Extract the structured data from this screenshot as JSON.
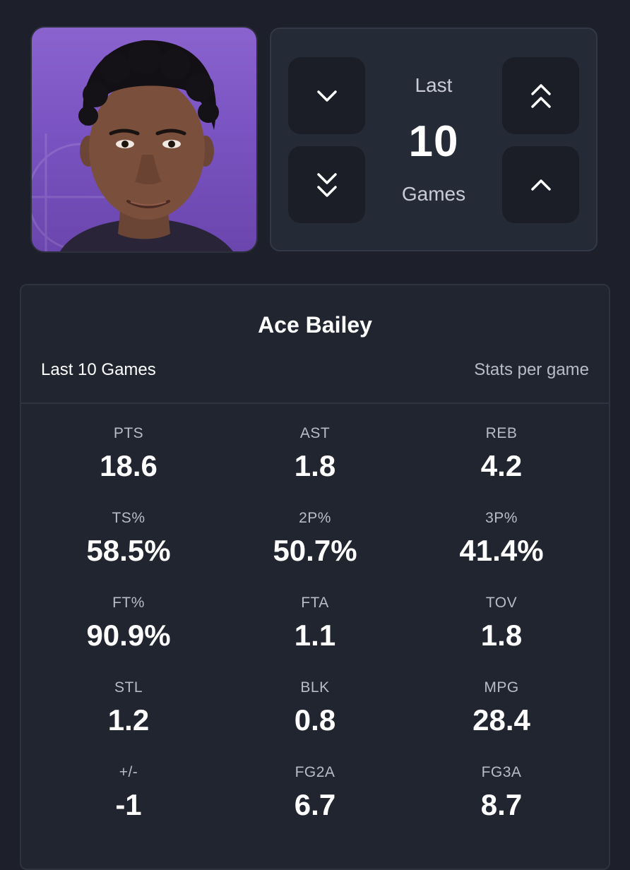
{
  "player": {
    "name": "Ace Bailey",
    "photo_alt": "Ace Bailey headshot"
  },
  "game_filter": {
    "prefix": "Last",
    "count": "10",
    "suffix": "Games",
    "buttons": {
      "decrease": "chevron-down-icon",
      "decrease_more": "double-chevron-down-icon",
      "increase_more": "double-chevron-up-icon",
      "increase": "chevron-up-icon"
    }
  },
  "stats_card": {
    "title": "Ace Bailey",
    "range_label": "Last 10 Games",
    "mode_label": "Stats per game",
    "stats": [
      {
        "label": "PTS",
        "value": "18.6"
      },
      {
        "label": "AST",
        "value": "1.8"
      },
      {
        "label": "REB",
        "value": "4.2"
      },
      {
        "label": "TS%",
        "value": "58.5%"
      },
      {
        "label": "2P%",
        "value": "50.7%"
      },
      {
        "label": "3P%",
        "value": "41.4%"
      },
      {
        "label": "FT%",
        "value": "90.9%"
      },
      {
        "label": "FTA",
        "value": "1.1"
      },
      {
        "label": "TOV",
        "value": "1.8"
      },
      {
        "label": "STL",
        "value": "1.2"
      },
      {
        "label": "BLK",
        "value": "0.8"
      },
      {
        "label": "MPG",
        "value": "28.4"
      },
      {
        "label": "+/-",
        "value": "-1"
      },
      {
        "label": "FG2A",
        "value": "6.7"
      },
      {
        "label": "FG3A",
        "value": "8.7"
      }
    ]
  },
  "colors": {
    "background": "#1d202a",
    "panel": "#252a37",
    "button": "#1b1e27",
    "card": "#21252f",
    "photo_bg": "#7a54c2",
    "muted_text": "#b9bcc8"
  }
}
